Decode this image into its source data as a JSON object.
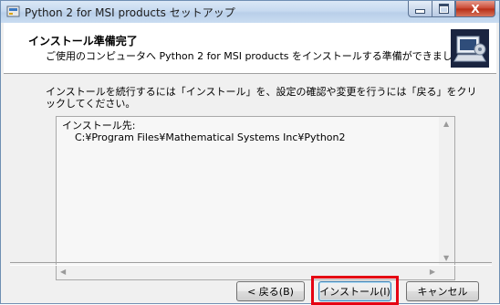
{
  "window": {
    "title": "Python 2 for MSI products セットアップ",
    "close_glyph": "X"
  },
  "header": {
    "title": "インストール準備完了",
    "subtitle": "ご使用のコンピュータへ Python 2 for MSI products をインストールする準備ができました。"
  },
  "body": {
    "instruction": "インストールを続行するには「インストール」を、設定の確認や変更を行うには「戻る」をクリックしてください。",
    "memo_text": "インストール先:\n    C:¥Program Files¥Mathematical Systems Inc¥Python2"
  },
  "buttons": {
    "back": "< 戻る(B)",
    "install": "インストール(I)",
    "cancel": "キャンセル"
  },
  "icons": {
    "app": "installer-app-icon",
    "header": "computer-setup-icon"
  },
  "colors": {
    "highlight": "#e50012"
  }
}
